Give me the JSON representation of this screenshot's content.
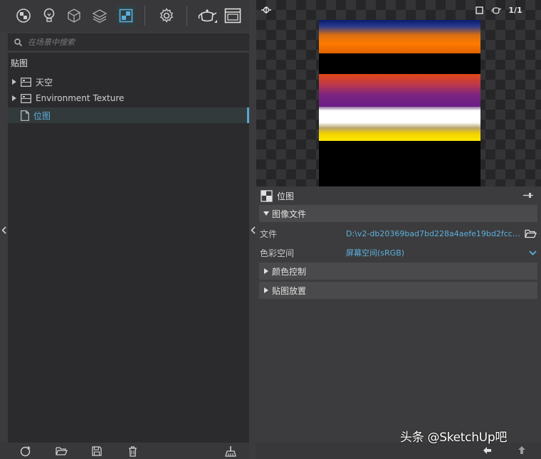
{
  "toolbar": {
    "icons": [
      "material-ball-icon",
      "light-bulb-icon",
      "cube-icon",
      "layers-icon",
      "texture-icon",
      "settings-gear-icon",
      "teapot-render-icon",
      "window-icon"
    ],
    "active": "texture-icon"
  },
  "search": {
    "placeholder": "在场景中搜索"
  },
  "tree": {
    "root_label": "贴图",
    "items": [
      {
        "label": "天空",
        "expandable": true,
        "selected": false
      },
      {
        "label": "Environment Texture",
        "expandable": true,
        "selected": false
      },
      {
        "label": "位图",
        "expandable": false,
        "selected": true
      }
    ]
  },
  "bottom_bar": {
    "icons": [
      "add-icon",
      "open-folder-icon",
      "save-icon",
      "delete-icon",
      "cleanup-broom-icon"
    ]
  },
  "preview": {
    "top_icons": [
      "link-icon",
      "square-icon",
      "teapot-icon"
    ],
    "ratio_label": "1/1",
    "texture_bands": [
      "blue-orange",
      "orange-purple",
      "white",
      "yellow"
    ]
  },
  "properties": {
    "title": "位图",
    "sections": {
      "image_file": "图像文件",
      "color_control": "颜色控制",
      "texture_placement": "贴图放置"
    },
    "file_label": "文件",
    "file_value": "D:\\v2-db20369bad7bd228a4aefe19bd2fcc6...",
    "colorspace_label": "色彩空间",
    "colorspace_value": "屏幕空间(sRGB)"
  },
  "watermark": "头条 @SketchUp吧",
  "colors": {
    "accent": "#5cb0dc",
    "panel": "#3b3b3d",
    "tree_bg": "#2b2b2d"
  }
}
